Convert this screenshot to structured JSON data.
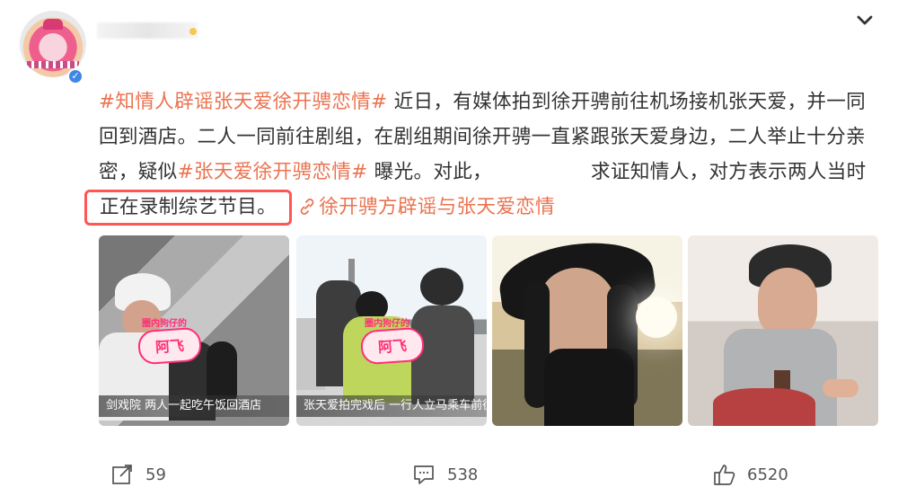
{
  "header": {
    "verified_badge": "✓"
  },
  "post": {
    "hashtag_1": "#知情人辟谣张天爱徐开骋恋情#",
    "text_1": " 近日，有媒体拍到徐开骋前往机场接机张天爱，并一同回到酒店。二人一同前往剧组，在剧组期间徐开骋一直紧跟张天爱身边，二人举止十分亲密，疑似",
    "hashtag_2": "#张天爱徐开骋恋情#",
    "text_2": " 曝光。对此，",
    "text_3": "求证知情人，对方表示两人当时",
    "highlight": "正在录制综艺节目。",
    "link": "徐开骋方辟谣与张天爱恋情"
  },
  "media": [
    {
      "caption": "剑戏院  两人一起吃午饭回酒店",
      "watermark": "阿飞",
      "watermark_top": "圈内狗仔的"
    },
    {
      "caption": "张天爱拍完戏后 一行人立马乘车前往",
      "watermark": "阿飞",
      "watermark_top": "圈内狗仔的"
    },
    {
      "caption": ""
    },
    {
      "caption": ""
    }
  ],
  "actions": {
    "share_count": "59",
    "comment_count": "538",
    "like_count": "6520"
  },
  "colors": {
    "hashtag": "#eb7350",
    "highlight_border": "#ff5555",
    "verified": "#3f87e6"
  }
}
